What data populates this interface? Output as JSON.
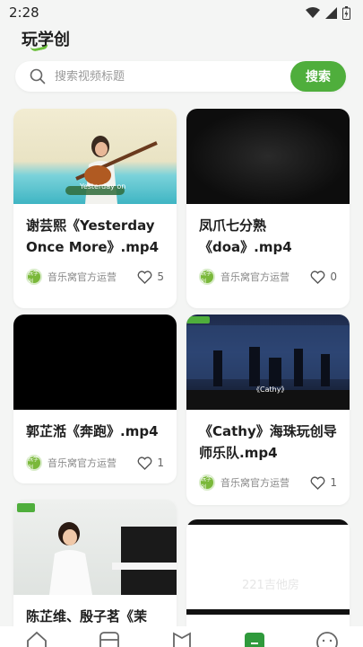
{
  "status_bar": {
    "time": "2:28"
  },
  "header": {
    "title": "玩学创"
  },
  "search": {
    "placeholder": "搜索视频标题",
    "button_label": "搜索"
  },
  "colors": {
    "accent": "#4fae3c",
    "background": "#f4f5f4",
    "card": "#ffffff"
  },
  "videos": [
    {
      "title": "谢芸熙《Yesterday Once More》.mp4",
      "author": "音乐窝官方运营",
      "likes": "5",
      "thumb_caption": "Yesterday on"
    },
    {
      "title": "凤爪七分熟《doa》.mp4",
      "author": "音乐窝官方运营",
      "likes": "0"
    },
    {
      "title": "郭芷湉《奔跑》.mp4",
      "author": "音乐窝官方运营",
      "likes": "1"
    },
    {
      "title": "《Cathy》海珠玩创导师乐队.mp4",
      "author": "音乐窝官方运营",
      "likes": "1",
      "thumb_caption": "《Cathy》"
    },
    {
      "title": "陈芷维、殷子茗《茉",
      "author": "",
      "likes": ""
    },
    {
      "title": "",
      "author": "",
      "likes": "",
      "thumb_caption": "221吉他房"
    }
  ],
  "avatar_text": "玩学创",
  "bottom_nav": {
    "items": [
      "home-icon",
      "media-icon",
      "book-icon",
      "create-icon",
      "profile-icon"
    ]
  }
}
